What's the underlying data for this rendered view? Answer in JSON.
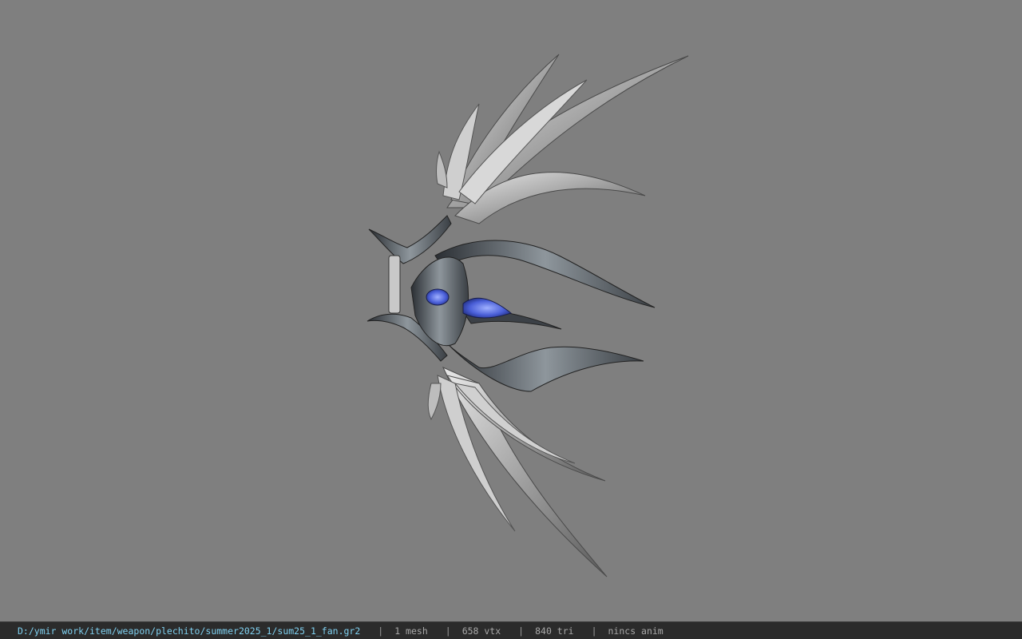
{
  "status_bar": {
    "file_path": "D:/ymir work/item/weapon/plechito/summer2025_1/sum25_1_fan.gr2",
    "separator": "|",
    "mesh_count": "1 mesh",
    "vertex_count": "658 vtx",
    "triangle_count": "840 tri",
    "animation": "nincs anim"
  },
  "viewport": {
    "background_color": "#7f7f7f",
    "model": "winged-fan-weapon"
  },
  "colors": {
    "path_text": "#7fd0f0",
    "stat_text": "#a8a8a8",
    "statusbar_bg": "#2b2b2b",
    "gem_blue": "#4a5fd8"
  }
}
